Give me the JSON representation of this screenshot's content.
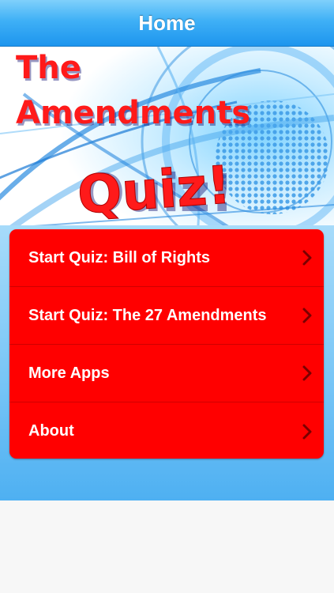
{
  "navbar": {
    "title": "Home"
  },
  "banner": {
    "title_line1": "The",
    "title_line2": "Amendments",
    "title_line3": "Quiz!"
  },
  "menu": {
    "items": [
      {
        "label": "Start Quiz: Bill of Rights",
        "icon": "chevron-right-icon"
      },
      {
        "label": "Start Quiz: The 27 Amendments",
        "icon": "chevron-right-icon"
      },
      {
        "label": "More Apps",
        "icon": "chevron-right-icon"
      },
      {
        "label": "About",
        "icon": "chevron-right-icon"
      }
    ]
  },
  "colors": {
    "navbar": "#3fb0f6",
    "menu_background": "#ff0000",
    "menu_text": "#ffffff",
    "content_background": "#79c6f6"
  }
}
